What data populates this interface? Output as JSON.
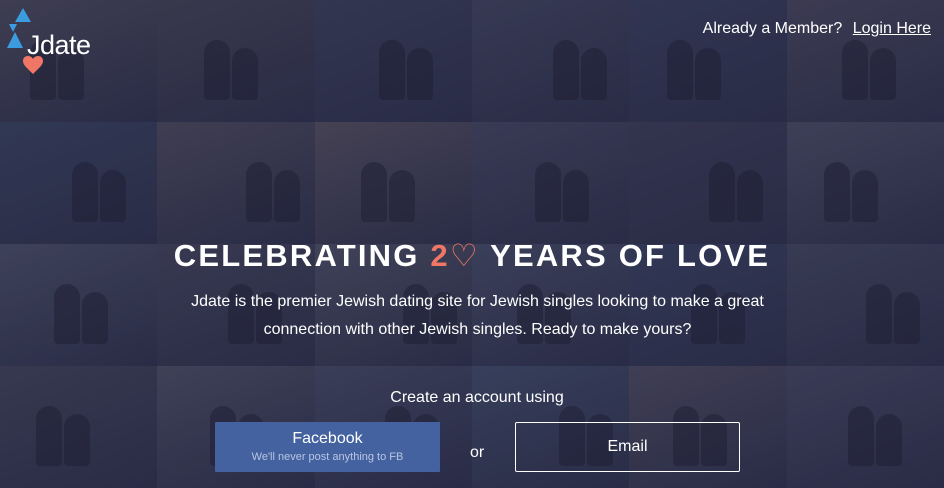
{
  "brand": {
    "name": "Jdate",
    "colors": {
      "blue": "#3b9de0",
      "heart": "#f07765"
    }
  },
  "header": {
    "member_prompt": "Already a Member?",
    "login_label": "Login Here"
  },
  "hero": {
    "headline_pre": "CELEBRATING ",
    "headline_accent": "2♡",
    "headline_post": " YEARS OF LOVE",
    "accent_color": "#f07765",
    "subtitle": "Jdate is the premier Jewish dating site for Jewish singles looking to make a great connection with other Jewish singles. Ready to make yours?"
  },
  "signup": {
    "prompt": "Create an account using",
    "facebook_label": "Facebook",
    "facebook_note": "We'll never post anything to FB",
    "or_label": "or",
    "email_label": "Email"
  },
  "background": {
    "tile_colors": [
      "#5a5560",
      "#4e4a56",
      "#3f4660",
      "#4a4e66",
      "#3c4462",
      "#555063",
      "#3d4b68",
      "#5c5662",
      "#6a5f66",
      "#4f4f68",
      "#41405a",
      "#5a5a6e",
      "#585e72",
      "#4d4c60",
      "#5e6070",
      "#525a74",
      "#3b4868",
      "#4c5066",
      "#4a4c5e",
      "#5b5e6e",
      "#505670",
      "#4a5a78",
      "#5e5868",
      "#51506a"
    ]
  }
}
